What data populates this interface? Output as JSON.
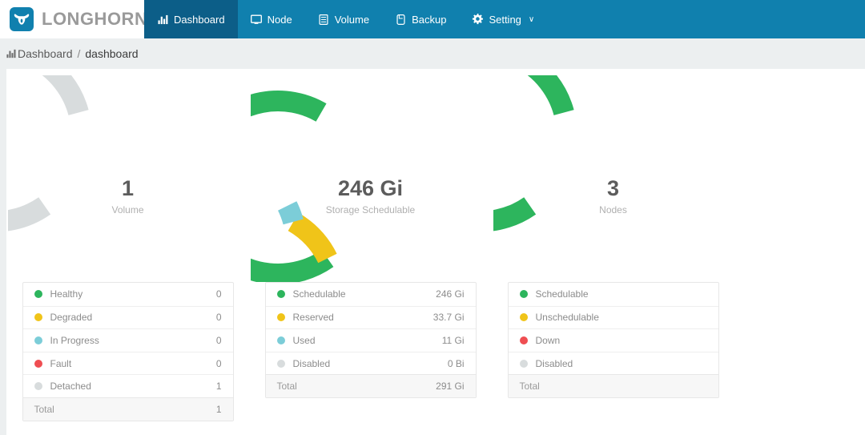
{
  "brand": {
    "name": "LONGHORN",
    "logo_icon": "longhorn-bull-icon",
    "logo_color": "#1080ae"
  },
  "nav": {
    "items": [
      {
        "label": "Dashboard",
        "icon": "bar-chart-icon",
        "active": true
      },
      {
        "label": "Node",
        "icon": "monitor-icon",
        "active": false
      },
      {
        "label": "Volume",
        "icon": "server-icon",
        "active": false
      },
      {
        "label": "Backup",
        "icon": "drive-icon",
        "active": false
      },
      {
        "label": "Setting",
        "icon": "gear-icon",
        "active": false,
        "caret": "∨"
      }
    ],
    "bar_color": "#1080ae",
    "active_color": "#0c5e88"
  },
  "breadcrumb": {
    "icon": "bar-chart-icon",
    "root": "Dashboard",
    "separator": "/",
    "current": "dashboard"
  },
  "colors": {
    "green": "#2db55d",
    "yellow": "#f0c419",
    "cyan": "#7ccdd8",
    "red": "#ef4e52",
    "grey": "#d8dcdd"
  },
  "cards": [
    {
      "gauge": {
        "value": "1",
        "label": "Volume",
        "segments": [
          {
            "name": "detached",
            "color": "#d8dcdd",
            "fraction": 1
          }
        ]
      },
      "legend": {
        "rows": [
          {
            "name": "Healthy",
            "color": "#2db55d",
            "value": "0"
          },
          {
            "name": "Degraded",
            "color": "#f0c419",
            "value": "0"
          },
          {
            "name": "In Progress",
            "color": "#7ccdd8",
            "value": "0"
          },
          {
            "name": "Fault",
            "color": "#ef4e52",
            "value": "0"
          },
          {
            "name": "Detached",
            "color": "#d8dcdd",
            "value": "1"
          }
        ],
        "total_label": "Total",
        "total_value": "1"
      }
    },
    {
      "gauge": {
        "value": "246 Gi",
        "label": "Storage Schedulable",
        "segments": [
          {
            "name": "schedulable",
            "color": "#2db55d",
            "fraction": 0.845
          },
          {
            "name": "reserved",
            "color": "#f0c419",
            "fraction": 0.116
          },
          {
            "name": "used",
            "color": "#7ccdd8",
            "fraction": 0.039
          }
        ]
      },
      "legend": {
        "rows": [
          {
            "name": "Schedulable",
            "color": "#2db55d",
            "value": "246 Gi"
          },
          {
            "name": "Reserved",
            "color": "#f0c419",
            "value": "33.7 Gi"
          },
          {
            "name": "Used",
            "color": "#7ccdd8",
            "value": "11 Gi"
          },
          {
            "name": "Disabled",
            "color": "#d8dcdd",
            "value": "0 Bi"
          }
        ],
        "total_label": "Total",
        "total_value": "291 Gi"
      }
    },
    {
      "gauge": {
        "value": "3",
        "label": "Nodes",
        "segments": [
          {
            "name": "schedulable",
            "color": "#2db55d",
            "fraction": 1
          }
        ]
      },
      "legend": {
        "rows": [
          {
            "name": "Schedulable",
            "color": "#2db55d",
            "value": ""
          },
          {
            "name": "Unschedulable",
            "color": "#f0c419",
            "value": ""
          },
          {
            "name": "Down",
            "color": "#ef4e52",
            "value": ""
          },
          {
            "name": "Disabled",
            "color": "#d8dcdd",
            "value": ""
          }
        ],
        "total_label": "Total",
        "total_value": ""
      }
    }
  ]
}
